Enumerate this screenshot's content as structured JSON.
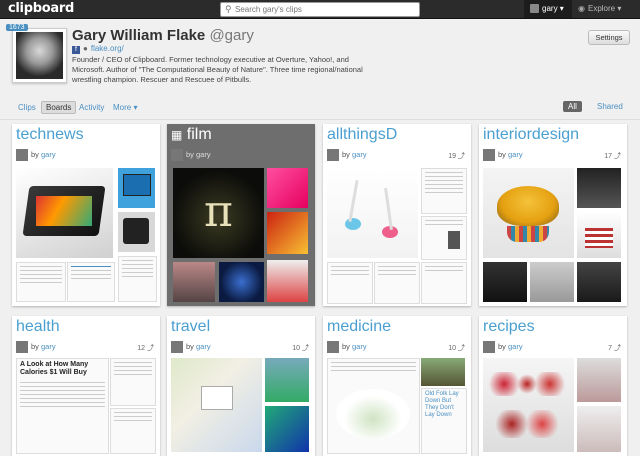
{
  "app": {
    "logo_text": "clipboard"
  },
  "search": {
    "placeholder": "Search gary's clips"
  },
  "user_menu": {
    "name": "gary",
    "arrow": "▾"
  },
  "explore": {
    "label": "Explore",
    "arrow": "▾"
  },
  "profile": {
    "badge": "1673",
    "name": "Gary William Flake",
    "handle": "@gary",
    "website": "flake.org/",
    "bio": "Founder / CEO of Clipboard. Former technology executive at Overture, Yahoo!, and Microsoft. Author of \"The Computational Beauty of Nature\". Three time regional/national wrestling champion. Rescuer and Rescuee of Pitbulls."
  },
  "settings_label": "Settings",
  "tabs": {
    "clips": "Clips",
    "boards": "Boards",
    "activity": "Activity",
    "more": "More ▾"
  },
  "filter": {
    "all": "All",
    "shared": "Shared"
  },
  "by_label": "by",
  "boards": [
    {
      "title": "technews",
      "user": "gary",
      "count": "",
      "hero_text": "Microsoft",
      "snippet_a": "\"I won't look for a great tablet\" Apple tomorrow...",
      "snippet_b": "Xbox: Xbox Windows 8 tablet Predictions for 2013"
    },
    {
      "title": "film",
      "user": "gary",
      "count": "",
      "hero_text": "π"
    },
    {
      "title": "allthingsD",
      "user": "gary",
      "count": "19",
      "hero_text": ""
    },
    {
      "title": "interiordesign",
      "user": "gary",
      "count": "17",
      "hero_text": ""
    },
    {
      "title": "health",
      "user": "gary",
      "count": "12",
      "hero_text": "A Look at How Many Calories $1 Will Buy"
    },
    {
      "title": "travel",
      "user": "gary",
      "count": "10",
      "hero_text": ""
    },
    {
      "title": "medicine",
      "user": "gary",
      "count": "10",
      "hero_text": "Old Folk Lay Down But They Don't Lay Down"
    },
    {
      "title": "recipes",
      "user": "gary",
      "count": "7",
      "hero_text": ""
    }
  ],
  "colors": {
    "accent": "#4a9fd0",
    "topbar": "#2b2b2b",
    "badge": "#4a8fc2"
  },
  "icons": {
    "search": "search-icon",
    "facebook": "facebook-icon",
    "globe": "globe-icon",
    "paperclip": "paperclip-icon",
    "explore": "compass-icon"
  }
}
